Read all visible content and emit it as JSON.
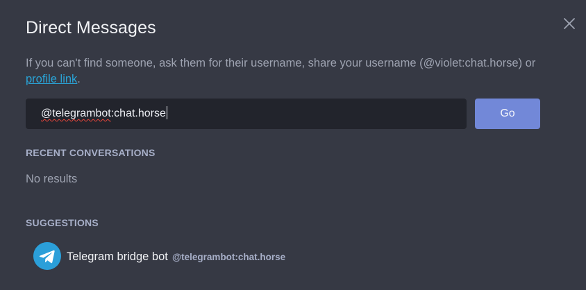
{
  "dialog": {
    "title": "Direct Messages",
    "info_text": "If you can't find someone, ask them for their username, share your username (@violet:chat.horse) or ",
    "profile_link_label": "profile link",
    "info_suffix": ".",
    "close_icon": "close-icon"
  },
  "search": {
    "value_misspelled": "@telegrambot",
    "value_rest": ":chat.horse",
    "go_label": "Go"
  },
  "recent": {
    "heading": "RECENT CONVERSATIONS",
    "empty_text": "No results"
  },
  "suggestions": {
    "heading": "SUGGESTIONS",
    "items": [
      {
        "name": "Telegram bridge bot",
        "user_id": "@telegrambot:chat.horse",
        "avatar_icon": "telegram-icon",
        "avatar_color": "#2b9fd9"
      }
    ]
  },
  "colors": {
    "background": "#363944",
    "input_background": "#22242c",
    "accent_button": "#7288d8",
    "link": "#2aa3d6",
    "spellcheck": "#e8443a"
  }
}
